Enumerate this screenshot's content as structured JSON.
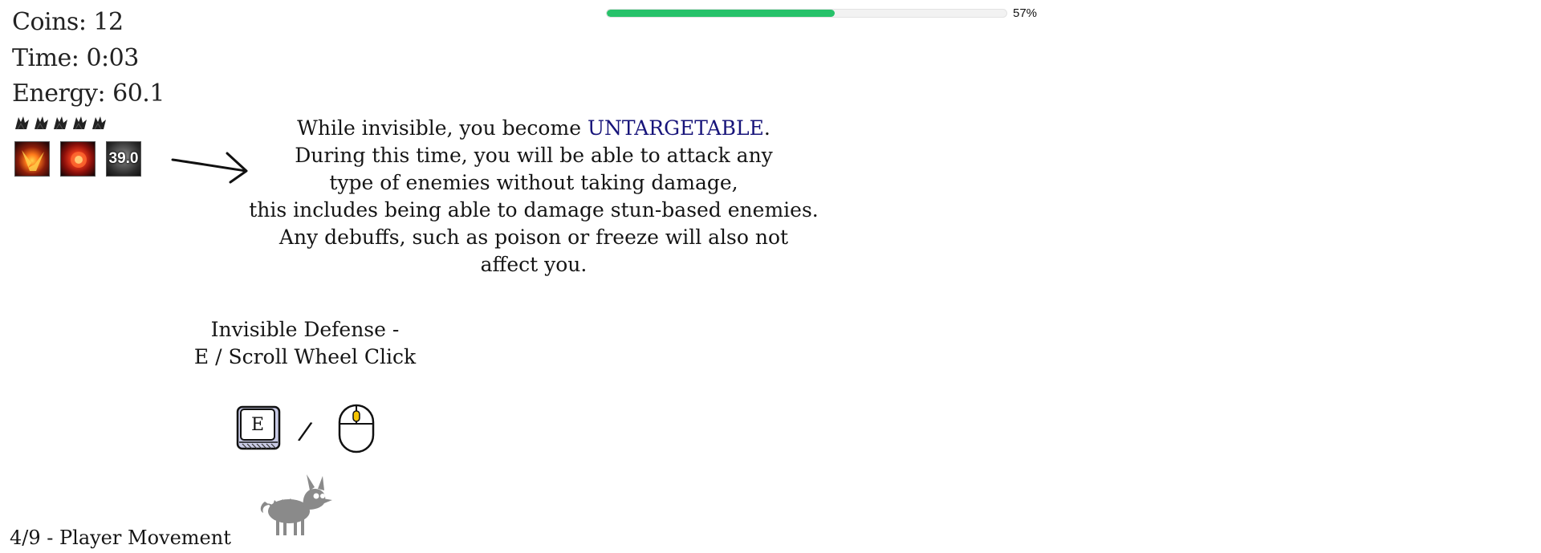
{
  "hud": {
    "coins": "Coins: 12",
    "time": "Time: 0:03",
    "energy": "Energy: 60.1",
    "lives": 5,
    "skills": [
      {
        "icon": "fire-burst-icon",
        "cooldown": ""
      },
      {
        "icon": "fireball-icon",
        "cooldown": ""
      },
      {
        "icon": "skull-icon",
        "cooldown": "39.0"
      }
    ]
  },
  "progress": {
    "percent": 57,
    "label": "57%",
    "color": "#27c26a"
  },
  "description": {
    "line1_prefix": "While invisible, you become ",
    "line1_highlight": "UNTARGETABLE",
    "line1_suffix": ".",
    "line2": "During this time, you will be able to attack any",
    "line3": "type of enemies without taking damage,",
    "line4": "this includes being able to damage stun-based enemies.",
    "line5": "Any debuffs, such as poison or freeze will also not",
    "line6": "affect you.",
    "highlight_color": "#17147a"
  },
  "ability": {
    "title_line1": "Invisible Defense -",
    "title_line2": "E / Scroll Wheel Click",
    "key_label": "E",
    "separator": "/"
  },
  "footer": {
    "page_label": "4/9 - Player Movement"
  }
}
